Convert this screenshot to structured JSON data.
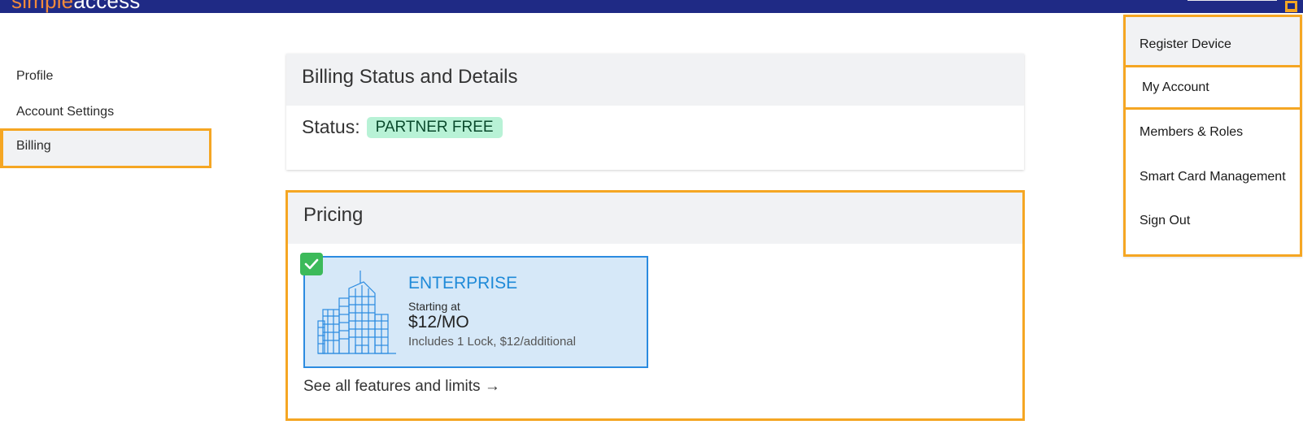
{
  "brand": {
    "part1": "simple",
    "part2": "access"
  },
  "sidebar": {
    "items": [
      {
        "label": "Profile"
      },
      {
        "label": "Account Settings"
      },
      {
        "label": "Billing"
      }
    ]
  },
  "billing_card": {
    "title": "Billing Status and Details",
    "status_label": "Status:",
    "status_value": "PARTNER FREE"
  },
  "pricing_card": {
    "title": "Pricing",
    "plan": {
      "name": "ENTERPRISE",
      "subtitle": "Starting at",
      "price": "$12/MO",
      "note": "Includes 1 Lock, $12/additional",
      "selected": true
    },
    "features_link": "See all features and limits →"
  },
  "account_menu": {
    "items": [
      {
        "label": "Register Device"
      },
      {
        "label": "My Account"
      },
      {
        "label": "Members & Roles"
      },
      {
        "label": "Smart Card Management"
      },
      {
        "label": "Sign Out"
      }
    ]
  },
  "colors": {
    "topbar": "#1f2a85",
    "brand_accent": "#f08a3c",
    "highlight": "#f5a623",
    "plan_blue": "#1f8ad8",
    "status_green_bg": "#b8f2d6",
    "check_green": "#3cba5a"
  }
}
